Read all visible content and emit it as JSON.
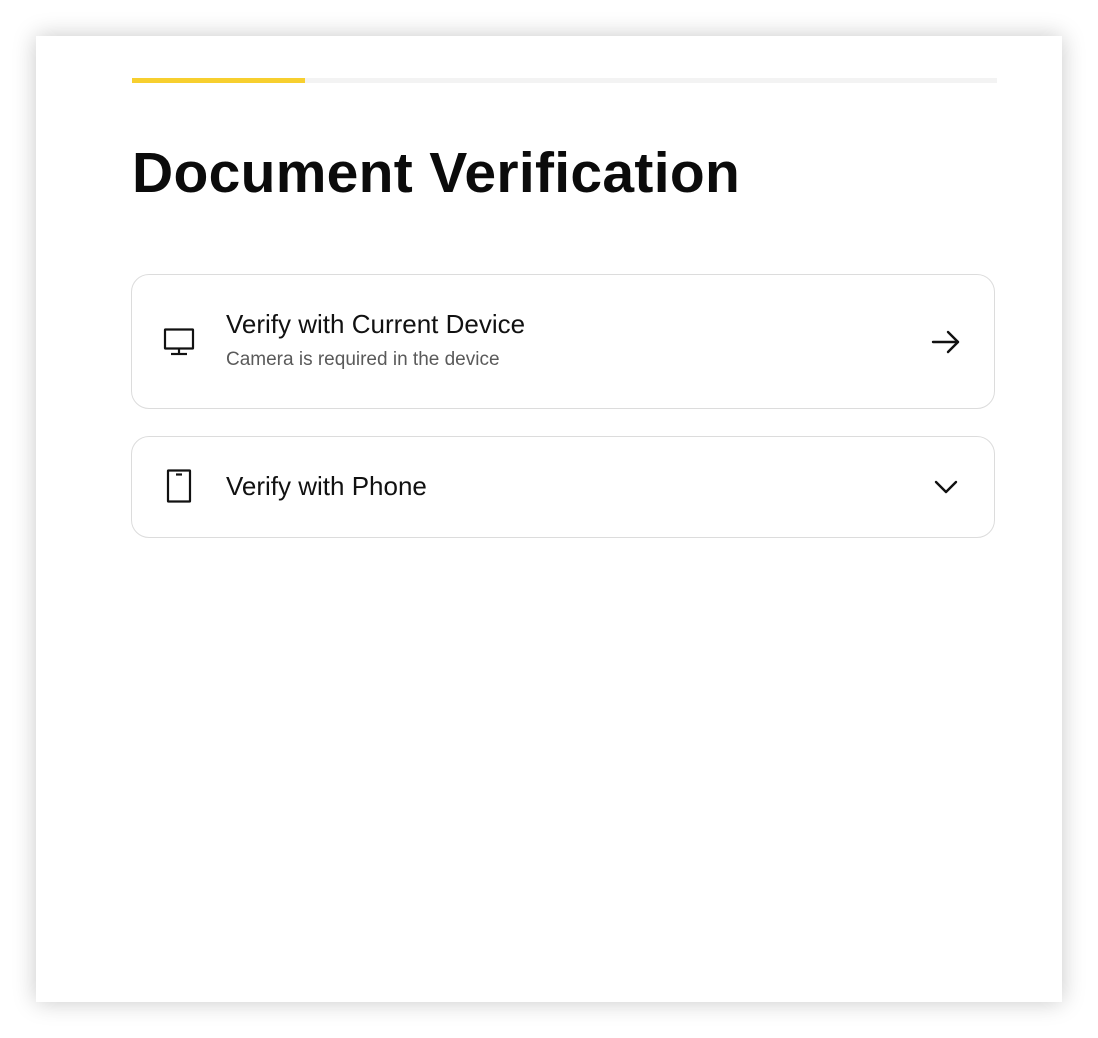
{
  "title": "Document Verification",
  "progress": {
    "fraction": 0.2,
    "color": "#f7cf2f"
  },
  "options": [
    {
      "icon": "monitor-icon",
      "title": "Verify with Current Device",
      "subtitle": "Camera is required in the device",
      "action_icon": "arrow-right-icon"
    },
    {
      "icon": "phone-icon",
      "title": "Verify with Phone",
      "action_icon": "chevron-down-icon"
    }
  ]
}
